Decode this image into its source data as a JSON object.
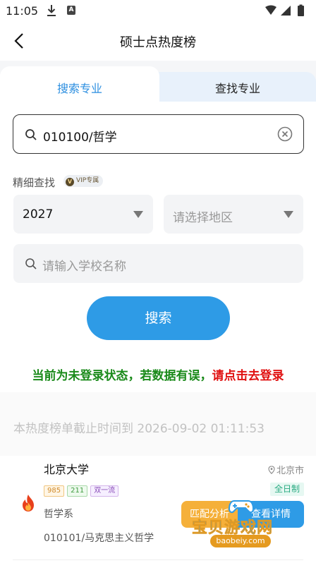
{
  "status_bar": {
    "time": "11:05"
  },
  "header": {
    "title": "硕士点热度榜"
  },
  "tabs": [
    {
      "label": "搜索专业",
      "active": true
    },
    {
      "label": "查找专业",
      "active": false
    }
  ],
  "search": {
    "value": "010100/哲学"
  },
  "filter": {
    "label": "精细查找",
    "vip_badge": "VIP专属",
    "year": "2027",
    "region_placeholder": "请选择地区",
    "school_placeholder": "请输入学校名称"
  },
  "search_button": "搜索",
  "login_notice": {
    "prefix": "当前为未登录状态，若数据有误，",
    "link": "请点击去登录"
  },
  "cutoff_note": "本热度榜单截止时间到 2026-09-02 01:11:53",
  "result": {
    "name": "北京大学",
    "location": "北京市",
    "tags": [
      "985",
      "211",
      "双一流"
    ],
    "mode": "全日制",
    "department": "哲学系",
    "major": "010101/马克思主义哲学",
    "match_button": "匹配分析",
    "detail_button": "查看详情"
  },
  "watermark": {
    "name": "宝贝游戏网",
    "url": "baobeiy.com"
  },
  "colors": {
    "accent": "#2e9be6",
    "login_green": "#1a8a1a",
    "login_red": "#e01010",
    "match": "#f5b03a"
  }
}
